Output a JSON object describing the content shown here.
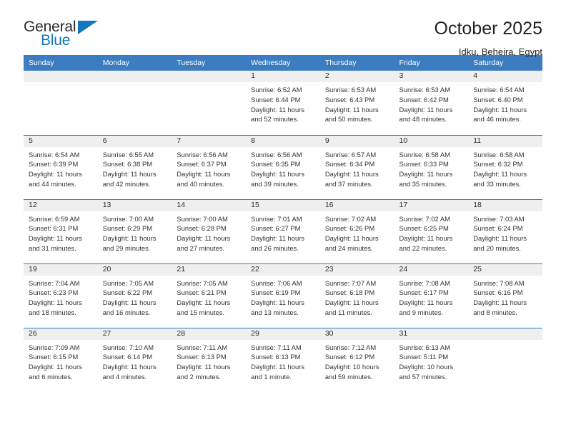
{
  "brand": {
    "name_part1": "General",
    "name_part2": "Blue",
    "flag_icon": "triangle-flag-icon",
    "accent_color": "#1277bc"
  },
  "header": {
    "title": "October 2025",
    "subtitle": "Idku, Beheira, Egypt"
  },
  "calendar": {
    "header_bg": "#3b7dc0",
    "row_divider_color": "#2e77b8",
    "daynum_band_bg": "#efefef",
    "weekday_headers": [
      "Sunday",
      "Monday",
      "Tuesday",
      "Wednesday",
      "Thursday",
      "Friday",
      "Saturday"
    ],
    "weeks": [
      [
        {
          "day": "",
          "lines": []
        },
        {
          "day": "",
          "lines": []
        },
        {
          "day": "",
          "lines": []
        },
        {
          "day": "1",
          "lines": [
            "Sunrise: 6:52 AM",
            "Sunset: 6:44 PM",
            "Daylight: 11 hours",
            "and 52 minutes."
          ]
        },
        {
          "day": "2",
          "lines": [
            "Sunrise: 6:53 AM",
            "Sunset: 6:43 PM",
            "Daylight: 11 hours",
            "and 50 minutes."
          ]
        },
        {
          "day": "3",
          "lines": [
            "Sunrise: 6:53 AM",
            "Sunset: 6:42 PM",
            "Daylight: 11 hours",
            "and 48 minutes."
          ]
        },
        {
          "day": "4",
          "lines": [
            "Sunrise: 6:54 AM",
            "Sunset: 6:40 PM",
            "Daylight: 11 hours",
            "and 46 minutes."
          ]
        }
      ],
      [
        {
          "day": "5",
          "lines": [
            "Sunrise: 6:54 AM",
            "Sunset: 6:39 PM",
            "Daylight: 11 hours",
            "and 44 minutes."
          ]
        },
        {
          "day": "6",
          "lines": [
            "Sunrise: 6:55 AM",
            "Sunset: 6:38 PM",
            "Daylight: 11 hours",
            "and 42 minutes."
          ]
        },
        {
          "day": "7",
          "lines": [
            "Sunrise: 6:56 AM",
            "Sunset: 6:37 PM",
            "Daylight: 11 hours",
            "and 40 minutes."
          ]
        },
        {
          "day": "8",
          "lines": [
            "Sunrise: 6:56 AM",
            "Sunset: 6:35 PM",
            "Daylight: 11 hours",
            "and 39 minutes."
          ]
        },
        {
          "day": "9",
          "lines": [
            "Sunrise: 6:57 AM",
            "Sunset: 6:34 PM",
            "Daylight: 11 hours",
            "and 37 minutes."
          ]
        },
        {
          "day": "10",
          "lines": [
            "Sunrise: 6:58 AM",
            "Sunset: 6:33 PM",
            "Daylight: 11 hours",
            "and 35 minutes."
          ]
        },
        {
          "day": "11",
          "lines": [
            "Sunrise: 6:58 AM",
            "Sunset: 6:32 PM",
            "Daylight: 11 hours",
            "and 33 minutes."
          ]
        }
      ],
      [
        {
          "day": "12",
          "lines": [
            "Sunrise: 6:59 AM",
            "Sunset: 6:31 PM",
            "Daylight: 11 hours",
            "and 31 minutes."
          ]
        },
        {
          "day": "13",
          "lines": [
            "Sunrise: 7:00 AM",
            "Sunset: 6:29 PM",
            "Daylight: 11 hours",
            "and 29 minutes."
          ]
        },
        {
          "day": "14",
          "lines": [
            "Sunrise: 7:00 AM",
            "Sunset: 6:28 PM",
            "Daylight: 11 hours",
            "and 27 minutes."
          ]
        },
        {
          "day": "15",
          "lines": [
            "Sunrise: 7:01 AM",
            "Sunset: 6:27 PM",
            "Daylight: 11 hours",
            "and 26 minutes."
          ]
        },
        {
          "day": "16",
          "lines": [
            "Sunrise: 7:02 AM",
            "Sunset: 6:26 PM",
            "Daylight: 11 hours",
            "and 24 minutes."
          ]
        },
        {
          "day": "17",
          "lines": [
            "Sunrise: 7:02 AM",
            "Sunset: 6:25 PM",
            "Daylight: 11 hours",
            "and 22 minutes."
          ]
        },
        {
          "day": "18",
          "lines": [
            "Sunrise: 7:03 AM",
            "Sunset: 6:24 PM",
            "Daylight: 11 hours",
            "and 20 minutes."
          ]
        }
      ],
      [
        {
          "day": "19",
          "lines": [
            "Sunrise: 7:04 AM",
            "Sunset: 6:23 PM",
            "Daylight: 11 hours",
            "and 18 minutes."
          ]
        },
        {
          "day": "20",
          "lines": [
            "Sunrise: 7:05 AM",
            "Sunset: 6:22 PM",
            "Daylight: 11 hours",
            "and 16 minutes."
          ]
        },
        {
          "day": "21",
          "lines": [
            "Sunrise: 7:05 AM",
            "Sunset: 6:21 PM",
            "Daylight: 11 hours",
            "and 15 minutes."
          ]
        },
        {
          "day": "22",
          "lines": [
            "Sunrise: 7:06 AM",
            "Sunset: 6:19 PM",
            "Daylight: 11 hours",
            "and 13 minutes."
          ]
        },
        {
          "day": "23",
          "lines": [
            "Sunrise: 7:07 AM",
            "Sunset: 6:18 PM",
            "Daylight: 11 hours",
            "and 11 minutes."
          ]
        },
        {
          "day": "24",
          "lines": [
            "Sunrise: 7:08 AM",
            "Sunset: 6:17 PM",
            "Daylight: 11 hours",
            "and 9 minutes."
          ]
        },
        {
          "day": "25",
          "lines": [
            "Sunrise: 7:08 AM",
            "Sunset: 6:16 PM",
            "Daylight: 11 hours",
            "and 8 minutes."
          ]
        }
      ],
      [
        {
          "day": "26",
          "lines": [
            "Sunrise: 7:09 AM",
            "Sunset: 6:15 PM",
            "Daylight: 11 hours",
            "and 6 minutes."
          ]
        },
        {
          "day": "27",
          "lines": [
            "Sunrise: 7:10 AM",
            "Sunset: 6:14 PM",
            "Daylight: 11 hours",
            "and 4 minutes."
          ]
        },
        {
          "day": "28",
          "lines": [
            "Sunrise: 7:11 AM",
            "Sunset: 6:13 PM",
            "Daylight: 11 hours",
            "and 2 minutes."
          ]
        },
        {
          "day": "29",
          "lines": [
            "Sunrise: 7:11 AM",
            "Sunset: 6:13 PM",
            "Daylight: 11 hours",
            "and 1 minute."
          ]
        },
        {
          "day": "30",
          "lines": [
            "Sunrise: 7:12 AM",
            "Sunset: 6:12 PM",
            "Daylight: 10 hours",
            "and 59 minutes."
          ]
        },
        {
          "day": "31",
          "lines": [
            "Sunrise: 6:13 AM",
            "Sunset: 5:11 PM",
            "Daylight: 10 hours",
            "and 57 minutes."
          ]
        },
        {
          "day": "",
          "lines": []
        }
      ]
    ]
  }
}
